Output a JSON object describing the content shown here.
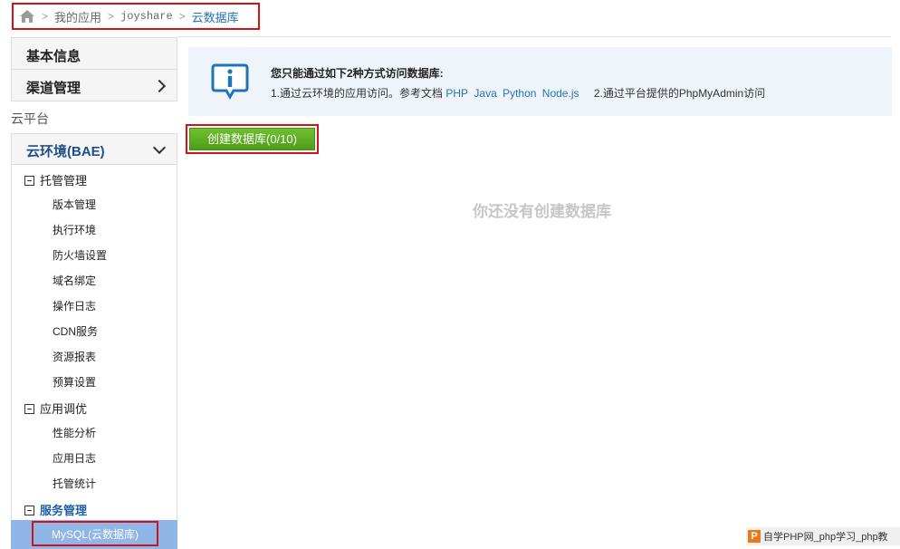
{
  "breadcrumb": {
    "home_icon": "home-icon",
    "items": [
      "我的应用",
      "joyshare",
      "云数据库"
    ]
  },
  "sidebar": {
    "basic_info": "基本信息",
    "channel_mgmt": "渠道管理",
    "section_label": "云平台",
    "cloud_env": "云环境(BAE)",
    "groups": [
      {
        "label": "托管管理",
        "items": [
          "版本管理",
          "执行环境",
          "防火墙设置",
          "域名绑定",
          "操作日志",
          "CDN服务",
          "资源报表",
          "预算设置"
        ]
      },
      {
        "label": "应用调优",
        "items": [
          "性能分析",
          "应用日志",
          "托管统计"
        ]
      },
      {
        "label": "服务管理",
        "items": [
          "MySQL(云数据库)"
        ]
      }
    ]
  },
  "notice": {
    "title": "您只能通过如下2种方式访问数据库:",
    "line_prefix": "1.通过云环境的应用访问。参考文档",
    "links": [
      "PHP",
      "Java",
      "Python",
      "Node.js"
    ],
    "line_suffix": "2.通过平台提供的PhpMyAdmin访问"
  },
  "create_button": "创建数据库(0/10)",
  "empty_text": "你还没有创建数据库",
  "watermark": {
    "logo": "P",
    "text": "自学PHP网_php学习_php教"
  },
  "colors": {
    "accent": "#1f74b5",
    "highlight": "#d0121b",
    "button": "#5aab22",
    "selected": "#8fb6e6"
  }
}
